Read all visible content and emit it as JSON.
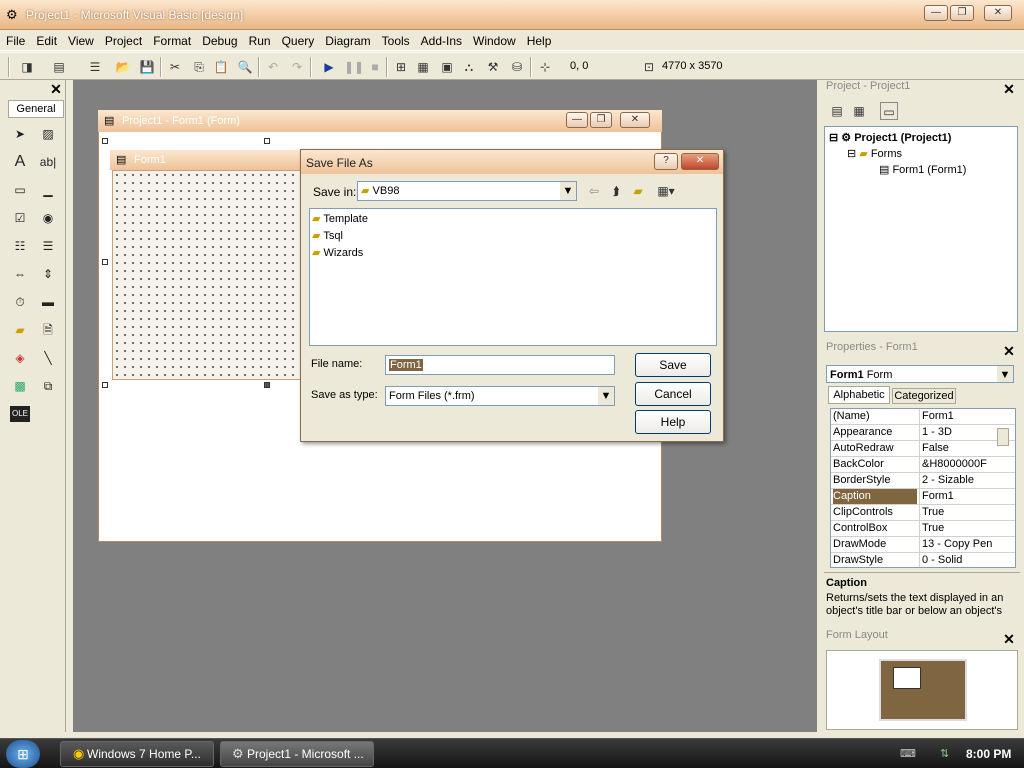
{
  "app": {
    "title": "Project1 - Microsoft Visual Basic [design]"
  },
  "menu": [
    "File",
    "Edit",
    "View",
    "Project",
    "Format",
    "Debug",
    "Run",
    "Query",
    "Diagram",
    "Tools",
    "Add-Ins",
    "Window",
    "Help"
  ],
  "toolbar": {
    "position": "0, 0",
    "size": "4770 x 3570"
  },
  "toolbox": {
    "tab": "General"
  },
  "form_window": {
    "outer_title": "Project1 - Form1 (Form)",
    "inner_title": "Form1"
  },
  "dialog": {
    "title": "Save File As",
    "save_in_label": "Save in:",
    "save_in_value": "VB98",
    "folders": [
      "Template",
      "Tsql",
      "Wizards"
    ],
    "file_name_label": "File name:",
    "file_name_value": "Form1",
    "save_as_type_label": "Save as type:",
    "save_as_type_value": "Form Files (*.frm)",
    "save_button": "Save",
    "cancel_button": "Cancel",
    "help_button": "Help",
    "help_glyph": "?"
  },
  "project": {
    "title": "Project - Project1",
    "root": "Project1 (Project1)",
    "folder": "Forms",
    "item": "Form1 (Form1)"
  },
  "properties": {
    "title": "Properties - Form1",
    "object_name": "Form1",
    "object_type": "Form",
    "tab_alphabetic": "Alphabetic",
    "tab_categorized": "Categorized",
    "rows": [
      {
        "name": "(Name)",
        "value": "Form1"
      },
      {
        "name": "Appearance",
        "value": "1 - 3D"
      },
      {
        "name": "AutoRedraw",
        "value": "False"
      },
      {
        "name": "BackColor",
        "value": "&H8000000F"
      },
      {
        "name": "BorderStyle",
        "value": "2 - Sizable"
      },
      {
        "name": "Caption",
        "value": "Form1"
      },
      {
        "name": "ClipControls",
        "value": "True"
      },
      {
        "name": "ControlBox",
        "value": "True"
      },
      {
        "name": "DrawMode",
        "value": "13 - Copy Pen"
      },
      {
        "name": "DrawStyle",
        "value": "0 - Solid"
      }
    ],
    "selected_row": 5,
    "desc_title": "Caption",
    "desc_text": "Returns/sets the text displayed in an object's title bar or below an object's"
  },
  "form_layout": {
    "title": "Form Layout"
  },
  "taskbar": {
    "tasks": [
      "Windows 7 Home P...",
      "Project1 - Microsoft ..."
    ],
    "clock": "8:00 PM"
  },
  "colors": {
    "selected_row": "#7f6540",
    "title_gradient": "#efc299",
    "desktop": "#808080"
  }
}
